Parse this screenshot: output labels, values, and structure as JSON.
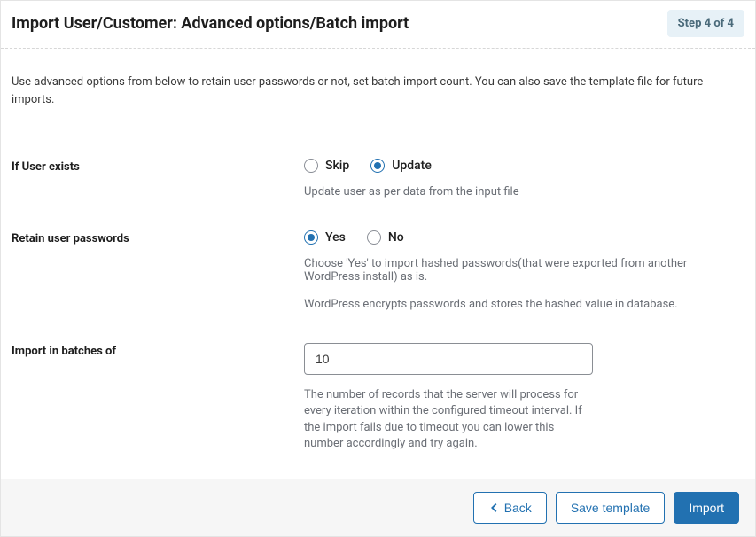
{
  "header": {
    "title": "Import User/Customer: Advanced options/Batch import",
    "step": "Step 4 of 4"
  },
  "intro": "Use advanced options from below to retain user passwords or not, set batch import count. You can also save the template file for future imports.",
  "fields": {
    "user_exists": {
      "label": "If User exists",
      "options": {
        "skip": "Skip",
        "update": "Update"
      },
      "selected": "update",
      "help": "Update user as per data from the input file"
    },
    "retain_passwords": {
      "label": "Retain user passwords",
      "options": {
        "yes": "Yes",
        "no": "No"
      },
      "selected": "yes",
      "help1": "Choose 'Yes' to import hashed passwords(that were exported from another WordPress install) as is.",
      "help2": "WordPress encrypts passwords and stores the hashed value in database."
    },
    "batch": {
      "label": "Import in batches of",
      "value": "10",
      "help": "The number of records that the server will process for every iteration within the configured timeout interval. If the import fails due to timeout you can lower this number accordingly and try again."
    }
  },
  "buttons": {
    "back": "Back",
    "save_template": "Save template",
    "import": "Import"
  }
}
